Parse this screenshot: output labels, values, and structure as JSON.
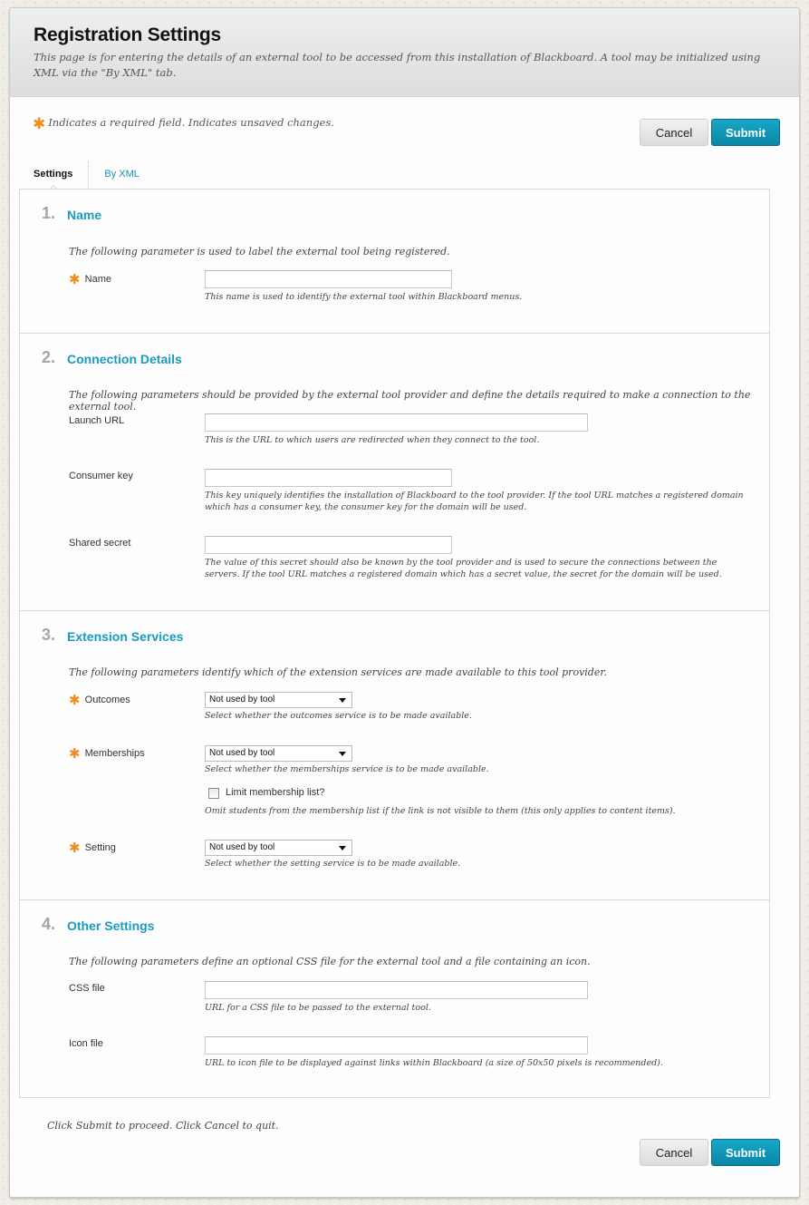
{
  "header": {
    "title": "Registration Settings",
    "description": "This page is for entering the details of an external tool to be accessed from this installation of Blackboard. A tool may be initialized using XML via the \"By XML\" tab."
  },
  "required_note": {
    "asterisk": "✱",
    "text": "Indicates a required field. Indicates unsaved changes."
  },
  "buttons": {
    "cancel": "Cancel",
    "submit": "Submit"
  },
  "colors": {
    "accent": "#1a9bc0",
    "required": "#f58a1f",
    "submit_bg": "#0f96b8"
  },
  "tabs": [
    {
      "label": "Settings",
      "active": true
    },
    {
      "label": "By XML",
      "active": false
    }
  ],
  "steps": [
    {
      "number": "1.",
      "title": "Name",
      "description": "The following parameter is used to label the external tool being registered.",
      "fields": [
        {
          "label": "Name",
          "required": true,
          "value": "",
          "hint": "This name is used to identify the external tool within Blackboard menus."
        }
      ]
    },
    {
      "number": "2.",
      "title": "Connection Details",
      "description": "The following parameters should be provided by the external tool provider and define the details required to make a connection to the external tool.",
      "fields": [
        {
          "label": "Launch URL",
          "required": false,
          "value": "",
          "hint": "This is the URL to which users are redirected when they connect to the tool."
        },
        {
          "label": "Consumer key",
          "required": false,
          "value": "",
          "hint": "This key uniquely identifies the installation of Blackboard to the tool provider. If the tool URL matches a registered domain which has a consumer key, the consumer key for the domain will be used."
        },
        {
          "label": "Shared secret",
          "required": false,
          "value": "",
          "hint": "The value of this secret should also be known by the tool provider and is used to secure the connections between the servers. If the tool URL matches a registered domain which has a secret value, the secret for the domain will be used."
        }
      ]
    },
    {
      "number": "3.",
      "title": "Extension Services",
      "description": "The following parameters identify which of the extension services are made available to this tool provider.",
      "fields": [
        {
          "label": "Outcomes",
          "required": true,
          "selected": "Not used by tool",
          "hint": "Select whether the outcomes service is to be made available."
        },
        {
          "label": "Memberships",
          "required": true,
          "selected": "Not used by tool",
          "hint": "Select whether the memberships service is to be made available."
        },
        {
          "label": "Setting",
          "required": true,
          "selected": "Not used by tool",
          "hint": "Select whether the setting service is to be made available."
        }
      ],
      "checkbox": {
        "label": "Limit membership list?",
        "checked": false,
        "hint": "Omit students from the membership list if the link is not visible to them (this only applies to content items)."
      }
    },
    {
      "number": "4.",
      "title": "Other Settings",
      "description": "The following parameters define an optional CSS file for the external tool and a file containing an icon.",
      "fields": [
        {
          "label": "CSS file",
          "required": false,
          "value": "",
          "hint": "URL for a CSS file to be passed to the external tool."
        },
        {
          "label": "Icon file",
          "required": false,
          "value": "",
          "hint": "URL to icon file to be displayed against links within Blackboard (a size of 50x50 pixels is recommended)."
        }
      ]
    }
  ],
  "footer": {
    "text": "Click Submit to proceed. Click Cancel to quit."
  }
}
